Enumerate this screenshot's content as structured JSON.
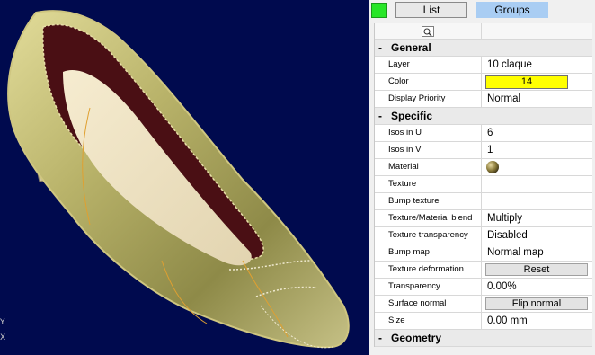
{
  "viewport": {
    "axis_y": "Y",
    "axis_x": "X",
    "background": "#000a4e"
  },
  "panel": {
    "indicator_color": "#28e628",
    "tabs": {
      "list": "List",
      "groups": "Groups"
    },
    "active_tab": "Groups",
    "search_icon": "magnifier-icon",
    "sections": {
      "general": "General",
      "specific": "Specific",
      "geometry": "Geometry"
    },
    "section_toggle": "-",
    "general": {
      "layer_label": "Layer",
      "layer_value": "10   claque",
      "color_label": "Color",
      "color_value": "14",
      "color_swatch": "#ffff00",
      "display_priority_label": "Display Priority",
      "display_priority_value": "Normal"
    },
    "specific": {
      "isos_u_label": "Isos in U",
      "isos_u_value": "6",
      "isos_v_label": "Isos in V",
      "isos_v_value": "1",
      "material_label": "Material",
      "material_icon": "material-sphere-icon",
      "texture_label": "Texture",
      "bump_texture_label": "Bump texture",
      "texture_blend_label": "Texture/Material blend",
      "texture_blend_value": "Multiply",
      "texture_transparency_label": "Texture transparency",
      "texture_transparency_value": "Disabled",
      "bump_map_label": "Bump map",
      "bump_map_value": "Normal map",
      "texture_deformation_label": "Texture deformation",
      "texture_deformation_button": "Reset",
      "transparency_label": "Transparency",
      "transparency_value": "0.00%",
      "surface_normal_label": "Surface normal",
      "surface_normal_button": "Flip normal",
      "size_label": "Size",
      "size_value": "0.00 mm"
    }
  }
}
